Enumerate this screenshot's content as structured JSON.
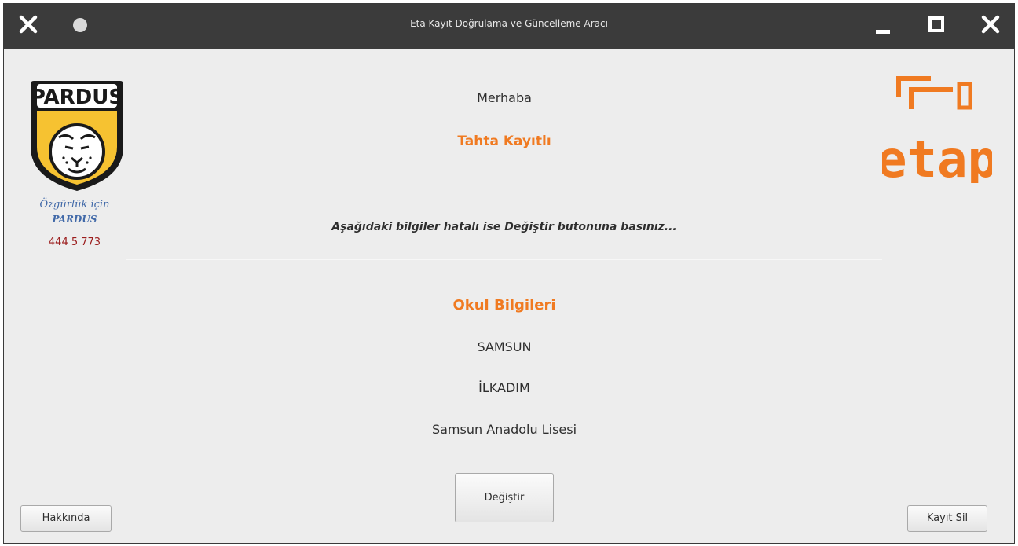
{
  "window": {
    "title": "Eta Kayıt Doğrulama ve Güncelleme Aracı"
  },
  "sidebar": {
    "pardus_logo_text": "PARDUS",
    "slogan_line1": "Özgürlük için",
    "slogan_line2": "PARDUS",
    "phone": "444 5 773",
    "etap_logo_text": "etap"
  },
  "main": {
    "greeting": "Merhaba",
    "status": "Tahta Kayıtlı",
    "notice": "Aşağıdaki bilgiler hatalı ise Değiştir butonuna basınız...",
    "section_title": "Okul Bilgileri",
    "city": "SAMSUN",
    "district": "İLKADIM",
    "school": "Samsun Anadolu Lisesi"
  },
  "buttons": {
    "change": "Değiştir",
    "about": "Hakkında",
    "delete": "Kayıt Sil"
  },
  "colors": {
    "accent": "#f07a21",
    "titlebar": "#3b3b3b",
    "slogan": "#4169a8",
    "phone": "#9b1c1c"
  }
}
